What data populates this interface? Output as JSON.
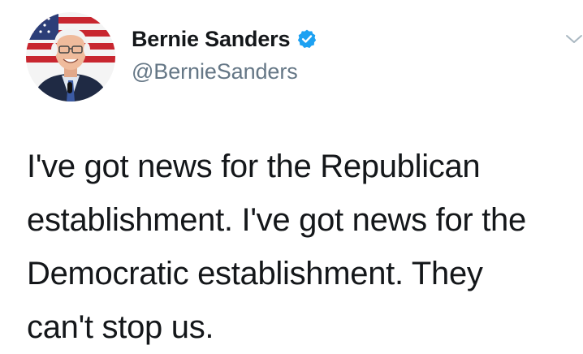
{
  "author": {
    "display_name": "Bernie Sanders",
    "handle": "@BernieSanders",
    "verified": true,
    "avatar_icon": "profile-avatar",
    "verified_icon": "verified-badge-icon",
    "verified_color": "#1da1f2"
  },
  "menu": {
    "icon": "chevron-down-icon"
  },
  "tweet": {
    "lines": [
      "I've got news for the Republican",
      "establishment. I've got news for the",
      "Democratic establishment. They",
      "can't stop us."
    ]
  },
  "colors": {
    "text": "#14171a",
    "secondary": "#657786",
    "accent": "#1da1f2",
    "background": "#ffffff"
  }
}
